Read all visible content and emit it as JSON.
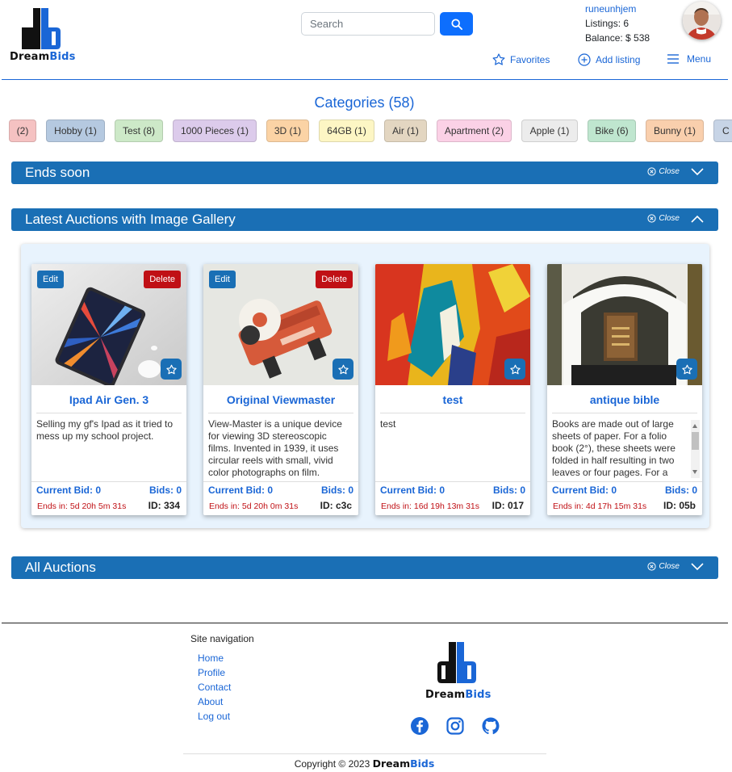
{
  "brand": {
    "part1": "Dream",
    "part2": "Bids"
  },
  "search": {
    "placeholder": "Search"
  },
  "user": {
    "name": "runeunhjem",
    "listings": "Listings: 6",
    "balance": "Balance: $ 538"
  },
  "nav": {
    "favorites": "Favorites",
    "add_listing": "Add listing",
    "menu": "Menu"
  },
  "categories": {
    "title": "Categories (58)",
    "items": [
      {
        "label": "(2)",
        "color": "#f5c2c2"
      },
      {
        "label": "Hobby (1)",
        "color": "#b5c9e0"
      },
      {
        "label": "Test (8)",
        "color": "#cde9c8"
      },
      {
        "label": "1000 Pieces (1)",
        "color": "#dccbeb"
      },
      {
        "label": "3D (1)",
        "color": "#fbd3a5"
      },
      {
        "label": "64GB (1)",
        "color": "#fdf6c4"
      },
      {
        "label": "Air (1)",
        "color": "#e3d6c1"
      },
      {
        "label": "Apartment (2)",
        "color": "#fbd1e6"
      },
      {
        "label": "Apple (1)",
        "color": "#ececec"
      },
      {
        "label": "Bike (6)",
        "color": "#bfe6cf"
      },
      {
        "label": "Bunny (1)",
        "color": "#f9cfad"
      },
      {
        "label": "C",
        "color": "#c7d4e6"
      }
    ]
  },
  "sections": {
    "ends_soon": "Ends soon",
    "latest": "Latest Auctions with Image Gallery",
    "all": "All Auctions",
    "close_label": "Close"
  },
  "cards": [
    {
      "title": "Ipad Air Gen. 3",
      "description": "Selling my gf's Ipad as it tried to mess up my school project.",
      "current_bid": "Current Bid: 0",
      "bids": "Bids: 0",
      "ends": "Ends in: 5d 20h 5m 31s",
      "id": "ID: 334",
      "edit": "Edit",
      "delete": "Delete"
    },
    {
      "title": "Original Viewmaster",
      "description": "View-Master is a unique device for viewing 3D stereoscopic films. Invented in 1939, it uses circular reels with small, vivid color photographs on film.",
      "current_bid": "Current Bid: 0",
      "bids": "Bids: 0",
      "ends": "Ends in: 5d 20h 0m 31s",
      "id": "ID: c3c",
      "edit": "Edit",
      "delete": "Delete"
    },
    {
      "title": "test",
      "description": "test",
      "current_bid": "Current Bid: 0",
      "bids": "Bids: 0",
      "ends": "Ends in: 16d 19h 13m 31s",
      "id": "ID: 017"
    },
    {
      "title": "antique bible",
      "description": "Books are made out of large sheets of paper. For a folio book (2°), these sheets were folded in half resulting in two leaves or four pages. For a",
      "current_bid": "Current Bid: 0",
      "bids": "Bids: 0",
      "ends": "Ends in: 4d 17h 15m 31s",
      "id": "ID: 05b"
    }
  ],
  "footer": {
    "site_nav_title": "Site navigation",
    "links": [
      "Home",
      "Profile",
      "Contact",
      "About",
      "Log out"
    ],
    "copyright": "Copyright © 2023"
  },
  "colors": {
    "accent": "#1a66d6",
    "bar": "#1a6fb5",
    "danger": "#c01015"
  }
}
